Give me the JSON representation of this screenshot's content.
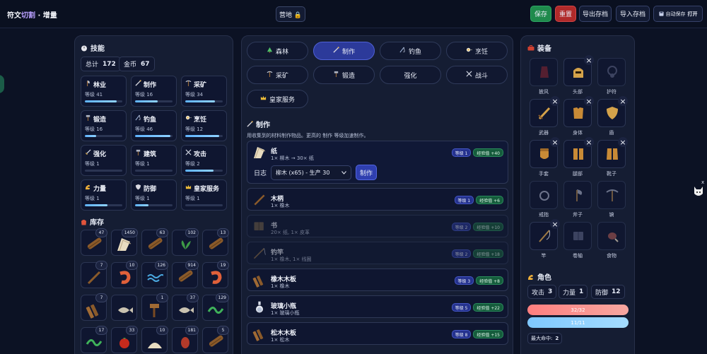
{
  "header": {
    "brand_main": "符文",
    "brand_accent": "切割",
    "brand_suffix": " · 增量",
    "camp_label": "营地 🔒",
    "save": "保存",
    "reset": "重置",
    "export": "导出存档",
    "import": "导入存档",
    "autosave_label": "自动保存",
    "autosave_state": "打开"
  },
  "skills_panel": {
    "title": "技能",
    "total_label": "总计",
    "total_value": "172",
    "gold_label": "金币",
    "gold_value": "67",
    "skills": [
      {
        "name": "林业",
        "level": "等级 41",
        "progress": 0.85
      },
      {
        "name": "制作",
        "level": "等级 16",
        "progress": 0.6
      },
      {
        "name": "采矿",
        "level": "等级 34",
        "progress": 0.8
      },
      {
        "name": "锻造",
        "level": "等级 16",
        "progress": 0.3
      },
      {
        "name": "钓鱼",
        "level": "等级 46",
        "progress": 0.95
      },
      {
        "name": "烹饪",
        "level": "等级 12",
        "progress": 0.9
      },
      {
        "name": "强化",
        "level": "等级 1",
        "progress": 0
      },
      {
        "name": "建筑",
        "level": "等级 1",
        "progress": 0
      },
      {
        "name": "攻击",
        "level": "等级 2",
        "progress": 0.75
      },
      {
        "name": "力量",
        "level": "等级 1",
        "progress": 0.6
      },
      {
        "name": "防御",
        "level": "等级 1",
        "progress": 0.35
      },
      {
        "name": "皇家服务",
        "level": "等级 1",
        "progress": 0
      }
    ]
  },
  "inventory": {
    "title": "库存",
    "items": [
      {
        "count": "47",
        "icon": "log-icon"
      },
      {
        "count": "1450",
        "icon": "paper-icon"
      },
      {
        "count": "63",
        "icon": "log-icon"
      },
      {
        "count": "102",
        "icon": "herb-icon"
      },
      {
        "count": "13",
        "icon": "log-icon"
      },
      {
        "count": "7",
        "icon": "stick-icon"
      },
      {
        "count": "10",
        "icon": "shrimp-icon"
      },
      {
        "count": "126",
        "icon": "water-icon"
      },
      {
        "count": "914",
        "icon": "log-icon"
      },
      {
        "count": "19",
        "icon": "shrimp-icon"
      },
      {
        "count": "7",
        "icon": "plank-icon"
      },
      {
        "count": "",
        "icon": "fish-icon"
      },
      {
        "count": "1",
        "icon": "hammer-icon"
      },
      {
        "count": "37",
        "icon": "fish-icon"
      },
      {
        "count": "129",
        "icon": "eel-icon"
      },
      {
        "count": "17",
        "icon": "eel-icon"
      },
      {
        "count": "33",
        "icon": "berry-icon"
      },
      {
        "count": "10",
        "icon": "powder-icon"
      },
      {
        "count": "181",
        "icon": "seed-icon"
      },
      {
        "count": "5",
        "icon": "log-icon"
      }
    ]
  },
  "categories": [
    {
      "label": "森林",
      "icon": "tree-icon",
      "active": false
    },
    {
      "label": "制作",
      "icon": "brush-icon",
      "active": true
    },
    {
      "label": "钓鱼",
      "icon": "fishing-icon",
      "active": false
    },
    {
      "label": "烹饪",
      "icon": "pan-icon",
      "active": false
    },
    {
      "label": "采矿",
      "icon": "pickaxe-icon",
      "active": false
    },
    {
      "label": "锻造",
      "icon": "hammer-icon",
      "active": false
    },
    {
      "label": "强化",
      "icon": "",
      "active": false
    },
    {
      "label": "战斗",
      "icon": "swords-icon",
      "active": false
    },
    {
      "label": "皇家服务",
      "icon": "crown-icon",
      "active": false
    }
  ],
  "crafting": {
    "title": "制作",
    "description": "用收集到的材料制作物品。更高的 制作 等级加速制作。",
    "featured": {
      "name": "纸",
      "sub": "1× 柳木 → 30× 纸",
      "level": "等级 1",
      "xp": "经验值 +40",
      "log_label": "日志",
      "select_value": "柳木 (x65) - 生产 30",
      "make_label": "制作"
    },
    "recipes": [
      {
        "name": "木柄",
        "sub": "1× 橡木",
        "level": "等级 1",
        "xp": "经验值 +6",
        "dim": false,
        "icon": "stick-icon"
      },
      {
        "name": "书",
        "sub": "20× 纸, 1× 皮革",
        "level": "等级 2",
        "xp": "经验值 +10",
        "dim": true,
        "icon": "book-icon"
      },
      {
        "name": "钓竿",
        "sub": "1× 橡木, 1× 线圈",
        "level": "等级 2",
        "xp": "经验值 +18",
        "dim": true,
        "icon": "rod-icon"
      },
      {
        "name": "橡木木板",
        "sub": "1× 橡木",
        "level": "等级 3",
        "xp": "经验值 +8",
        "dim": false,
        "icon": "plank-icon"
      },
      {
        "name": "玻璃小瓶",
        "sub": "1× 玻璃小瓶",
        "level": "等级 5",
        "xp": "经验值 +22",
        "dim": false,
        "icon": "vial-icon"
      },
      {
        "name": "松木木板",
        "sub": "1× 松木",
        "level": "等级 8",
        "xp": "经验值 +15",
        "dim": false,
        "icon": "plank-icon"
      }
    ]
  },
  "equipment": {
    "title": "装备",
    "slots": [
      {
        "label": "披风",
        "filled": false,
        "icon": "cape-icon"
      },
      {
        "label": "头部",
        "filled": true,
        "icon": "helmet-icon"
      },
      {
        "label": "护符",
        "filled": false,
        "icon": "amulet-icon"
      },
      {
        "label": "武器",
        "filled": true,
        "icon": "sword-icon"
      },
      {
        "label": "身体",
        "filled": true,
        "icon": "armor-icon"
      },
      {
        "label": "盾",
        "filled": true,
        "icon": "shield-icon"
      },
      {
        "label": "手套",
        "filled": true,
        "icon": "gauntlet-icon"
      },
      {
        "label": "腿部",
        "filled": true,
        "icon": "legs-icon"
      },
      {
        "label": "靴子",
        "filled": true,
        "icon": "boots-icon"
      },
      {
        "label": "戒指",
        "filled": false,
        "icon": "ring-icon"
      },
      {
        "label": "斧子",
        "filled": false,
        "icon": "axe-icon"
      },
      {
        "label": "镐",
        "filled": false,
        "icon": "pickaxe-icon"
      },
      {
        "label": "竿",
        "filled": true,
        "icon": "rod-icon"
      },
      {
        "label": "卷轴",
        "filled": false,
        "icon": "scroll-icon"
      },
      {
        "label": "食物",
        "filled": false,
        "icon": "meat-icon"
      }
    ]
  },
  "character": {
    "title": "角色",
    "attack_label": "攻击",
    "attack_value": "3",
    "strength_label": "力量",
    "strength_value": "1",
    "defense_label": "防御",
    "defense_value": "12",
    "hp_text": "32/32",
    "mp_text": "11/11",
    "max_hit_label": "最大命中:",
    "max_hit_value": "2"
  },
  "widget": {
    "close": "x"
  },
  "colors": {
    "accent": "#2c3a9a",
    "save": "#1f8a4c",
    "reset": "#b02a2a",
    "xp": "#155c3c",
    "hp": "#ff7f7f",
    "mp": "#7fc8ff"
  }
}
